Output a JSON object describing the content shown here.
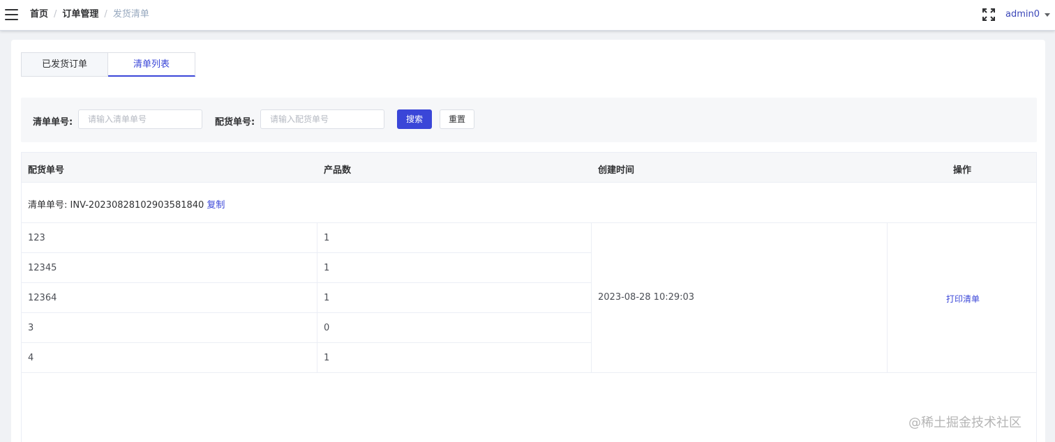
{
  "navbar": {
    "breadcrumb": [
      "首页",
      "订单管理",
      "发货清单"
    ],
    "separator": "/",
    "user": "admin0"
  },
  "tabs": [
    {
      "label": "已发货订单",
      "active": false
    },
    {
      "label": "清单列表",
      "active": true
    }
  ],
  "search": {
    "list_no_label": "清单单号:",
    "list_no_placeholder": "请输入清单单号",
    "dist_no_label": "配货单号:",
    "dist_no_placeholder": "请输入配货单号",
    "search_button": "搜索",
    "reset_button": "重置"
  },
  "table": {
    "headers": [
      "配货单号",
      "产品数",
      "创建时间",
      "操作"
    ],
    "group": {
      "label": "清单单号: INV-20230828102903581840",
      "copy": "复制"
    },
    "rows": [
      {
        "dist_no": "123",
        "count": "1"
      },
      {
        "dist_no": "12345",
        "count": "1"
      },
      {
        "dist_no": "12364",
        "count": "1"
      },
      {
        "dist_no": "3",
        "count": "0"
      },
      {
        "dist_no": "4",
        "count": "1"
      }
    ],
    "created_time": "2023-08-28 10:29:03",
    "action": "打印清单"
  },
  "watermark": "@稀土掘金技术社区",
  "colors": {
    "accent": "#3a46d8",
    "muted": "#97a8be"
  }
}
